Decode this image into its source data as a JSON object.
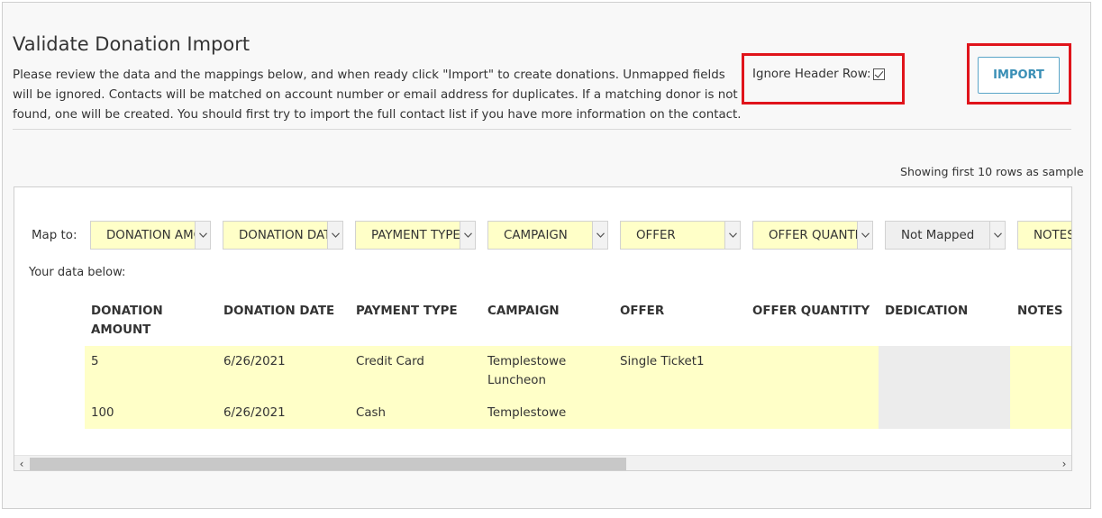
{
  "header": {
    "title": "Validate Donation Import",
    "description_lines": [
      "Please review the data and the mappings below, and when ready click \"Import\" to create donations. Unmapped fields",
      "will be ignored. Contacts will be matched on account number or email address for duplicates. If a matching donor is not",
      "found, one will be created. You should first try to import the full contact list if you have more information on the contact."
    ],
    "ignore_header_label": "Ignore Header Row:",
    "ignore_header_checked": true,
    "import_button": "IMPORT"
  },
  "sample_note": "Showing first 10 rows as sample",
  "mapping": {
    "label": "Map to:",
    "selects": [
      {
        "value": "DONATION AMOUNT",
        "mapped": true
      },
      {
        "value": "DONATION DATE",
        "mapped": true
      },
      {
        "value": "PAYMENT TYPE",
        "mapped": true
      },
      {
        "value": "CAMPAIGN",
        "mapped": true
      },
      {
        "value": "OFFER",
        "mapped": true
      },
      {
        "value": "OFFER QUANTITY",
        "mapped": true
      },
      {
        "value": "Not Mapped",
        "mapped": false
      },
      {
        "value": "NOTES",
        "mapped": true
      }
    ]
  },
  "data_label": "Your data below:",
  "table": {
    "headers": [
      "DONATION AMOUNT",
      "DONATION DATE",
      "PAYMENT TYPE",
      "CAMPAIGN",
      "OFFER",
      "OFFER QUANTITY",
      "DEDICATION",
      "NOTES"
    ],
    "rows": [
      [
        "5",
        "6/26/2021",
        "Credit Card",
        "Templestowe Luncheon",
        "Single Ticket1",
        "",
        "",
        ""
      ],
      [
        "100",
        "6/26/2021",
        "Cash",
        "Templestowe",
        "",
        "",
        "",
        ""
      ]
    ]
  },
  "colors": {
    "mapped_bg": "#ffffc8",
    "unmapped_bg": "#ececec",
    "highlight_border": "#e0141b",
    "import_text": "#3a8fb6"
  }
}
